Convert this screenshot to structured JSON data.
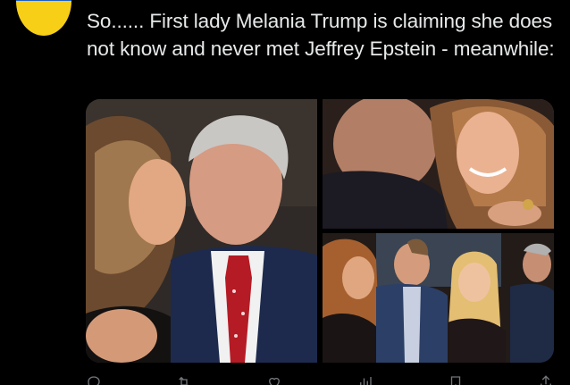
{
  "tweet": {
    "text": "So...... First lady Melania Trump is claiming she does not know and never met Jeffrey Epstein - meanwhile:",
    "avatar_icon": "ukraine-flag-avatar",
    "colors": {
      "background": "#000000",
      "text": "#e7e9ea",
      "muted": "#71767b",
      "flag_blue": "#1a5fc7",
      "flag_yellow": "#f7cf16"
    }
  },
  "media": {
    "count": 3,
    "photos": [
      {
        "position": "left",
        "subject": "woman kissing man in suit and red tie"
      },
      {
        "position": "top-right",
        "subject": "man and woman cheek to cheek, smiling"
      },
      {
        "position": "bottom-right",
        "subject": "group photo at event"
      }
    ]
  },
  "actions": [
    {
      "name": "reply",
      "icon": "reply-icon"
    },
    {
      "name": "retweet",
      "icon": "retweet-icon"
    },
    {
      "name": "like",
      "icon": "heart-icon"
    },
    {
      "name": "views",
      "icon": "views-icon"
    },
    {
      "name": "bookmark",
      "icon": "bookmark-icon"
    },
    {
      "name": "share",
      "icon": "share-icon"
    }
  ]
}
